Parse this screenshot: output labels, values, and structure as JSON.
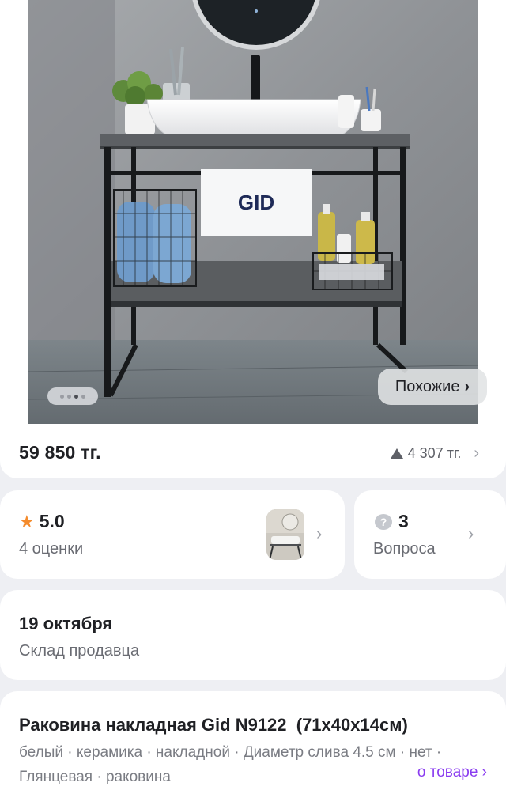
{
  "gallery": {
    "towel_brand": "GID",
    "similar_label": "Похожие",
    "similar_chevron": "›",
    "dots_count": 4,
    "active_dot": 3
  },
  "price": {
    "current": "59 850 тг.",
    "installment": "4 307 тг.",
    "chevron": "›"
  },
  "rating": {
    "value": "5.0",
    "count_label": "4 оценки",
    "star_icon": "★",
    "chevron": "›"
  },
  "questions": {
    "count": "3",
    "label": "Вопроса",
    "icon": "?",
    "chevron": "›"
  },
  "delivery": {
    "date": "19 октября",
    "source": "Склад продавца"
  },
  "product": {
    "title": "Раковина накладная Gid N9122  (71x40x14см)",
    "attributes": "белый · керамика · накладной · Диаметр слива 4.5 см · нет · Глянцевая · раковина",
    "about_link": "о товаре ›"
  },
  "colors": {
    "accent": "#8a3cf0",
    "star": "#f48b2c",
    "background": "#eeeff3"
  }
}
